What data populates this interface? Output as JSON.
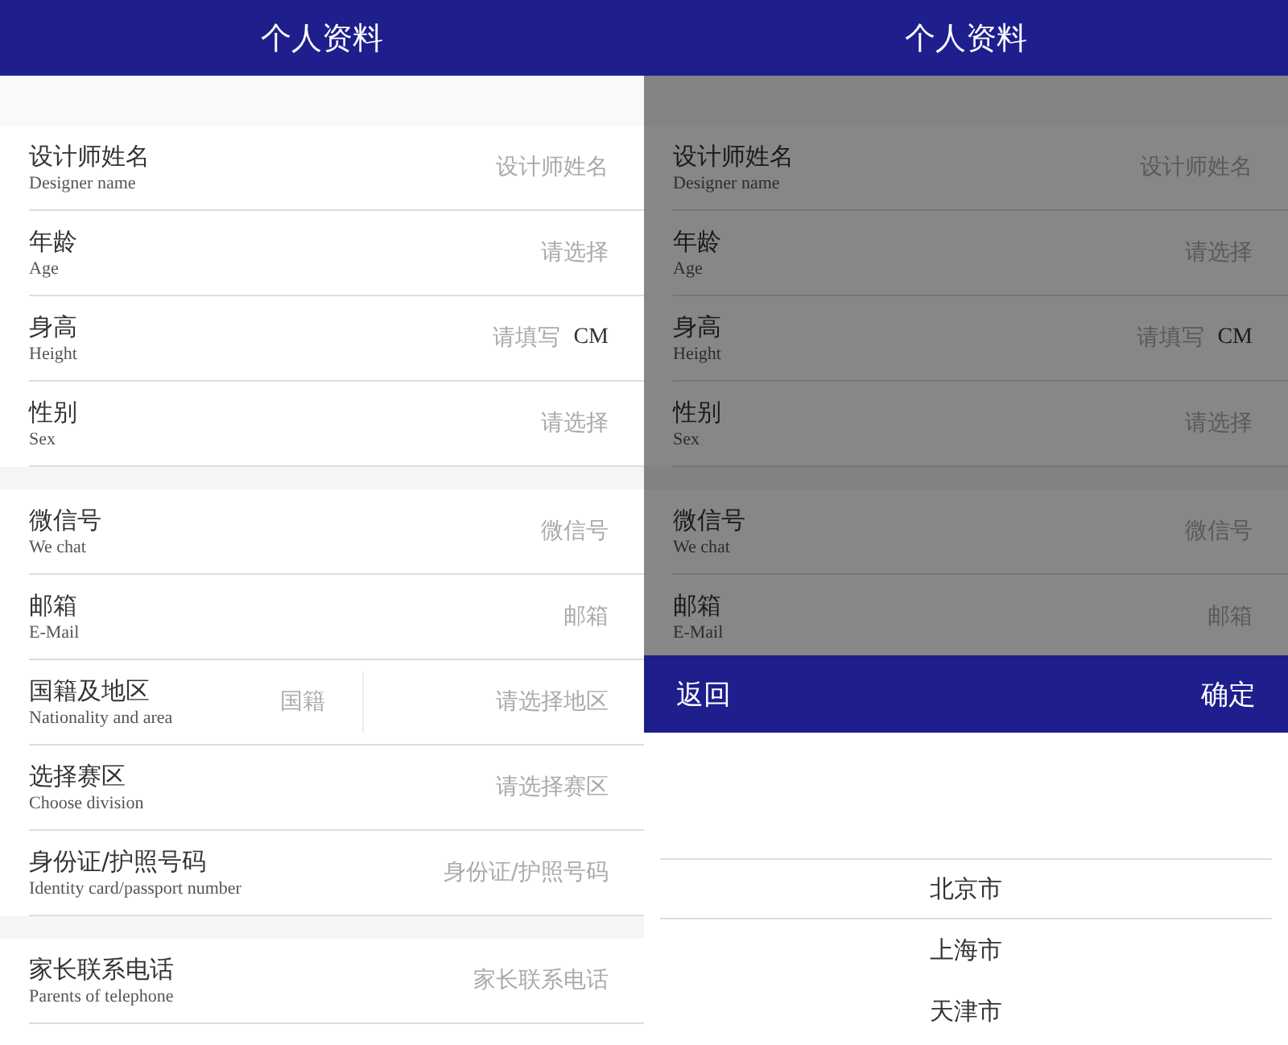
{
  "screens": [
    {
      "title": "个人资料",
      "groups": [
        [
          {
            "label": "设计师姓名",
            "sublabel": "Designer name",
            "kind": "text",
            "placeholder": "设计师姓名"
          },
          {
            "label": "年龄",
            "sublabel": "Age",
            "kind": "select",
            "placeholder": "请选择"
          },
          {
            "label": "身高",
            "sublabel": "Height",
            "kind": "unit",
            "placeholder": "请填写",
            "unit": "CM"
          },
          {
            "label": "性别",
            "sublabel": "Sex",
            "kind": "select",
            "placeholder": "请选择"
          }
        ],
        [
          {
            "label": "微信号",
            "sublabel": "We chat",
            "kind": "text",
            "placeholder": "微信号"
          },
          {
            "label": "邮箱",
            "sublabel": "E-Mail",
            "kind": "text",
            "placeholder": "邮箱"
          },
          {
            "label": "国籍及地区",
            "sublabel": "Nationality and area",
            "kind": "dual",
            "placeholder": "国籍",
            "placeholder_2": "请选择地区"
          },
          {
            "label": "选择赛区",
            "sublabel": "Choose division",
            "kind": "select",
            "placeholder": "请选择赛区"
          },
          {
            "label": "身份证/护照号码",
            "sublabel": "Identity card/passport number",
            "kind": "text",
            "placeholder": "身份证/护照号码"
          }
        ],
        [
          {
            "label": "家长联系电话",
            "sublabel": "Parents of telephone",
            "kind": "text",
            "placeholder": "家长联系电话"
          }
        ]
      ]
    },
    {
      "title": "个人资料",
      "groups": [
        [
          {
            "label": "设计师姓名",
            "sublabel": "Designer name",
            "kind": "text",
            "placeholder": "设计师姓名"
          },
          {
            "label": "年龄",
            "sublabel": "Age",
            "kind": "select",
            "placeholder": "请选择"
          },
          {
            "label": "身高",
            "sublabel": "Height",
            "kind": "unit",
            "placeholder": "请填写",
            "unit": "CM"
          },
          {
            "label": "性别",
            "sublabel": "Sex",
            "kind": "select",
            "placeholder": "请选择"
          }
        ],
        [
          {
            "label": "微信号",
            "sublabel": "We chat",
            "kind": "text",
            "placeholder": "微信号"
          },
          {
            "label": "邮箱",
            "sublabel": "E-Mail",
            "kind": "text",
            "placeholder": "邮箱"
          }
        ]
      ],
      "picker": {
        "back": "返回",
        "confirm": "确定",
        "options": [
          {
            "label": "北京市",
            "selected": true
          },
          {
            "label": "上海市",
            "selected": false
          },
          {
            "label": "天津市",
            "selected": false
          }
        ]
      }
    }
  ]
}
